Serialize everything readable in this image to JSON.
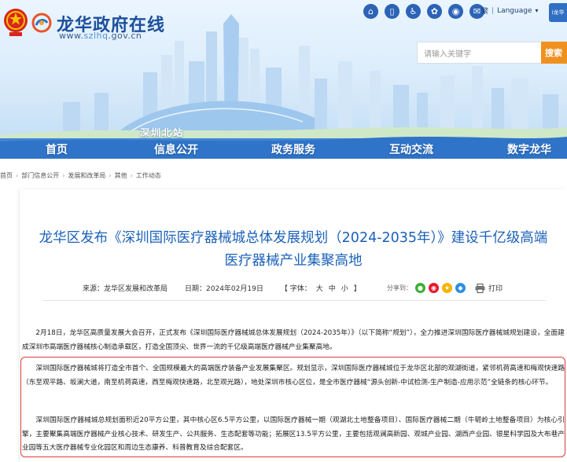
{
  "header": {
    "site_name": "龙华政府在线",
    "url_prefix": "www.",
    "url_sub": "szlhq",
    "url_suffix": ".gov.cn",
    "lang_simplified": "繁",
    "lang_label": "Language",
    "app_badge": "i龙华",
    "tool_icons": [
      "home-icon",
      "mobile-icon",
      "accessibility-icon",
      "mini-program-icon",
      "weibo-icon",
      "wechat-icon"
    ],
    "search": {
      "placeholder": "请输入关键字",
      "button": "搜索"
    },
    "station_sign": "深圳北站",
    "nav": [
      "首页",
      "信息公开",
      "政务服务",
      "互动交流",
      "数字龙华"
    ]
  },
  "breadcrumb": [
    "首页",
    "部门信息公开",
    "发展和改革局",
    "其他",
    "工作动态"
  ],
  "article": {
    "title": "龙华区发布《深圳国际医疗器械城总体发展规划（2024-2035年）》建设千亿级高端医疗器械产业集聚高地",
    "source_label": "来源：龙华区发展和改革局",
    "date_label": "日期：2024年02月19日",
    "font_label": "【 字体：",
    "font_sizes": [
      "大",
      "中",
      "小"
    ],
    "font_close": "】",
    "share_label": "分享到：",
    "print_label": "打印",
    "paragraphs": [
      "2月18日，龙华区高质量发展大会召开，正式发布《深圳国际医疗器械城总体发展规划（2024-2035年）》（以下简称“规划”），全力推进深圳国际医疗器械城规划建设，全面建成深圳市高端医疗器械核心制造承载区，打造全国顶尖、世界一流的千亿级高端医疗器械产业集聚高地。",
      "深圳国际医疗器械城将打造全市首个、全国规模最大的高端医疗装备产业发展集聚区。规划显示，深圳国际医疗器械城位于龙华区北部的观湖街道，紧邻机荷高速和梅观快速路（东至观平路、坂澜大道，南至机荷高速，西至梅观快速路，北至观光路），地处深圳市核心区位，是全市医疗器械“源头创新-中试检测-生产制造-应用示范”全链条的核心环节。",
      "深圳国际医疗器械城总规划面积近20平方公里，其中核心区6.5平方公里，以国际医疗器械一期（观湖北土地整备项目）、国际医疗器械二期（牛轭岭土地整备项目）为核心引擎，主要聚集高端医疗器械产业核心技术、研发生产、公共服务、生态配套等功能；拓展区13.5平方公里，主要包括观澜高新园、观城产业园、湖西产业园、银星科学园及大布巷产业园等五大医疗器械专业化园区和周边生态康养、科普教育及综合配套区。"
    ]
  }
}
